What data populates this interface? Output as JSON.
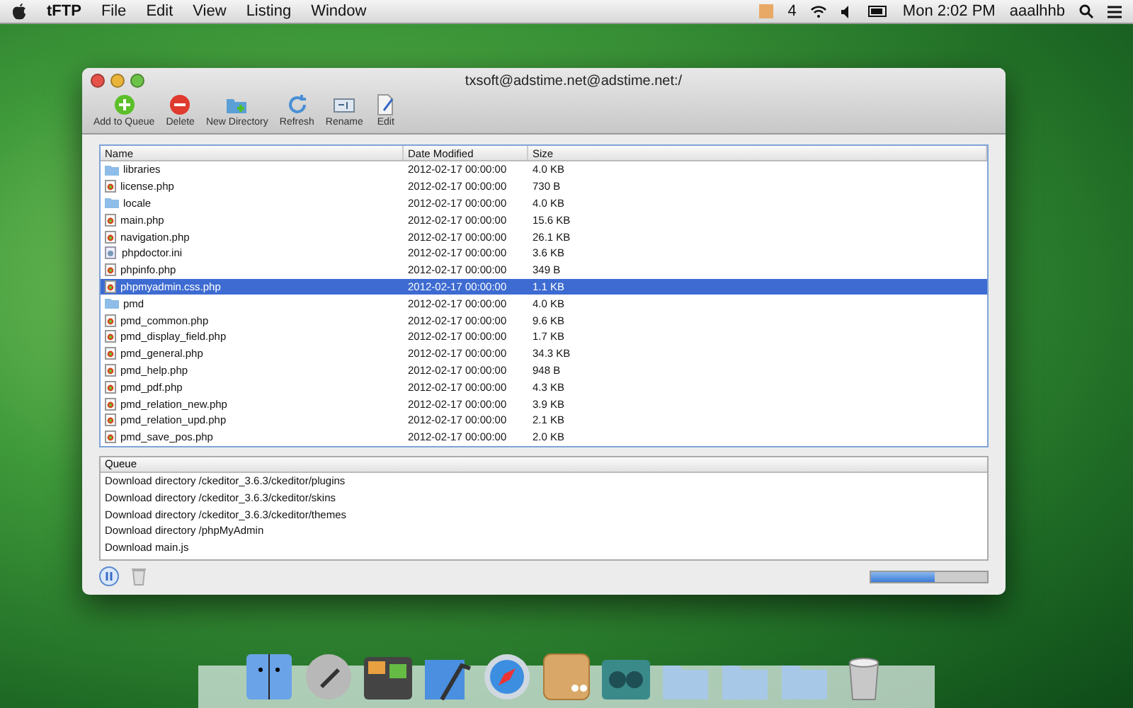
{
  "menu_bar": {
    "app": "tFTP",
    "menus": [
      "File",
      "Edit",
      "View",
      "Listing",
      "Window"
    ],
    "status_text": "4",
    "clock": "Mon 2:02 PM",
    "user": "aaalhhb"
  },
  "window": {
    "title": "txsoft@adstime.net@adstime.net:/"
  },
  "toolbar": [
    {
      "kind": "add",
      "label": "Add to Queue"
    },
    {
      "kind": "delete",
      "label": "Delete"
    },
    {
      "kind": "newdir",
      "label": "New Directory"
    },
    {
      "kind": "refresh",
      "label": "Refresh"
    },
    {
      "kind": "rename",
      "label": "Rename"
    },
    {
      "kind": "edit",
      "label": "Edit"
    }
  ],
  "table": {
    "columns": [
      "Name",
      "Date Modified",
      "Size"
    ],
    "rows": [
      {
        "kind": "folder",
        "name": "libraries",
        "date": "2012-02-17 00:00:00",
        "size": "4.0 KB",
        "selected": false
      },
      {
        "kind": "php",
        "name": "license.php",
        "date": "2012-02-17 00:00:00",
        "size": "730 B",
        "selected": false
      },
      {
        "kind": "folder",
        "name": "locale",
        "date": "2012-02-17 00:00:00",
        "size": "4.0 KB",
        "selected": false
      },
      {
        "kind": "php",
        "name": "main.php",
        "date": "2012-02-17 00:00:00",
        "size": "15.6 KB",
        "selected": false
      },
      {
        "kind": "php",
        "name": "navigation.php",
        "date": "2012-02-17 00:00:00",
        "size": "26.1 KB",
        "selected": false
      },
      {
        "kind": "ini",
        "name": "phpdoctor.ini",
        "date": "2012-02-17 00:00:00",
        "size": "3.6 KB",
        "selected": false
      },
      {
        "kind": "php",
        "name": "phpinfo.php",
        "date": "2012-02-17 00:00:00",
        "size": "349 B",
        "selected": false
      },
      {
        "kind": "php",
        "name": "phpmyadmin.css.php",
        "date": "2012-02-17 00:00:00",
        "size": "1.1 KB",
        "selected": true
      },
      {
        "kind": "folder",
        "name": "pmd",
        "date": "2012-02-17 00:00:00",
        "size": "4.0 KB",
        "selected": false
      },
      {
        "kind": "php",
        "name": "pmd_common.php",
        "date": "2012-02-17 00:00:00",
        "size": "9.6 KB",
        "selected": false
      },
      {
        "kind": "php",
        "name": "pmd_display_field.php",
        "date": "2012-02-17 00:00:00",
        "size": "1.7 KB",
        "selected": false
      },
      {
        "kind": "php",
        "name": "pmd_general.php",
        "date": "2012-02-17 00:00:00",
        "size": "34.3 KB",
        "selected": false
      },
      {
        "kind": "php",
        "name": "pmd_help.php",
        "date": "2012-02-17 00:00:00",
        "size": "948 B",
        "selected": false
      },
      {
        "kind": "php",
        "name": "pmd_pdf.php",
        "date": "2012-02-17 00:00:00",
        "size": "4.3 KB",
        "selected": false
      },
      {
        "kind": "php",
        "name": "pmd_relation_new.php",
        "date": "2012-02-17 00:00:00",
        "size": "3.9 KB",
        "selected": false
      },
      {
        "kind": "php",
        "name": "pmd_relation_upd.php",
        "date": "2012-02-17 00:00:00",
        "size": "2.1 KB",
        "selected": false
      },
      {
        "kind": "php",
        "name": "pmd_save_pos.php",
        "date": "2012-02-17 00:00:00",
        "size": "2.0 KB",
        "selected": false
      }
    ]
  },
  "queue": {
    "title": "Queue",
    "items": [
      "Download directory /ckeditor_3.6.3/ckeditor/plugins",
      "Download directory /ckeditor_3.6.3/ckeditor/skins",
      "Download directory /ckeditor_3.6.3/ckeditor/themes",
      "Download directory /phpMyAdmin",
      "Download main.js"
    ]
  },
  "progress": {
    "level": 0.55
  }
}
